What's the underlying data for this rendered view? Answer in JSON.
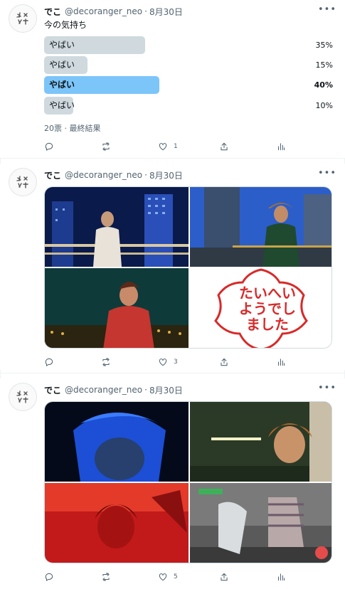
{
  "tweets": [
    {
      "name": "でこ",
      "handle": "@decoranger_neo",
      "dot": "·",
      "date": "8月30日",
      "text": "今の気持ち",
      "poll": {
        "options": [
          {
            "label": "やばい",
            "percent_text": "35%",
            "percent": 35,
            "winner": false
          },
          {
            "label": "やばい",
            "percent_text": "15%",
            "percent": 15,
            "winner": false
          },
          {
            "label": "やばい",
            "percent_text": "40%",
            "percent": 40,
            "winner": true
          },
          {
            "label": "やばい",
            "percent_text": "10%",
            "percent": 10,
            "winner": false
          }
        ],
        "meta": "20票 · 最終結果"
      },
      "actions": {
        "reply": "",
        "retweet": "",
        "like": "1"
      }
    },
    {
      "name": "でこ",
      "handle": "@decoranger_neo",
      "dot": "·",
      "date": "8月30日",
      "media": {
        "photos": [
          "night-city-balcony-photo",
          "city-skyline-railing-photo",
          "red-outfit-portrait-photo",
          "sticker-flower-text-photo"
        ],
        "sticker_text": [
          "たいへい",
          "ようでし",
          "ました"
        ]
      },
      "actions": {
        "reply": "",
        "retweet": "",
        "like": "3"
      }
    },
    {
      "name": "でこ",
      "handle": "@decoranger_neo",
      "dot": "·",
      "date": "8月30日",
      "media": {
        "photos": [
          "blue-hair-portrait-photo",
          "parking-garage-portrait-photo",
          "red-light-portrait-photo",
          "dance-motion-photo"
        ]
      },
      "actions": {
        "reply": "",
        "retweet": "",
        "like": "5"
      }
    }
  ],
  "colors": {
    "poll_bar": "#cfd9de",
    "poll_winner": "#7cc5f9",
    "secondary_text": "#536471",
    "border": "#eff3f4"
  }
}
